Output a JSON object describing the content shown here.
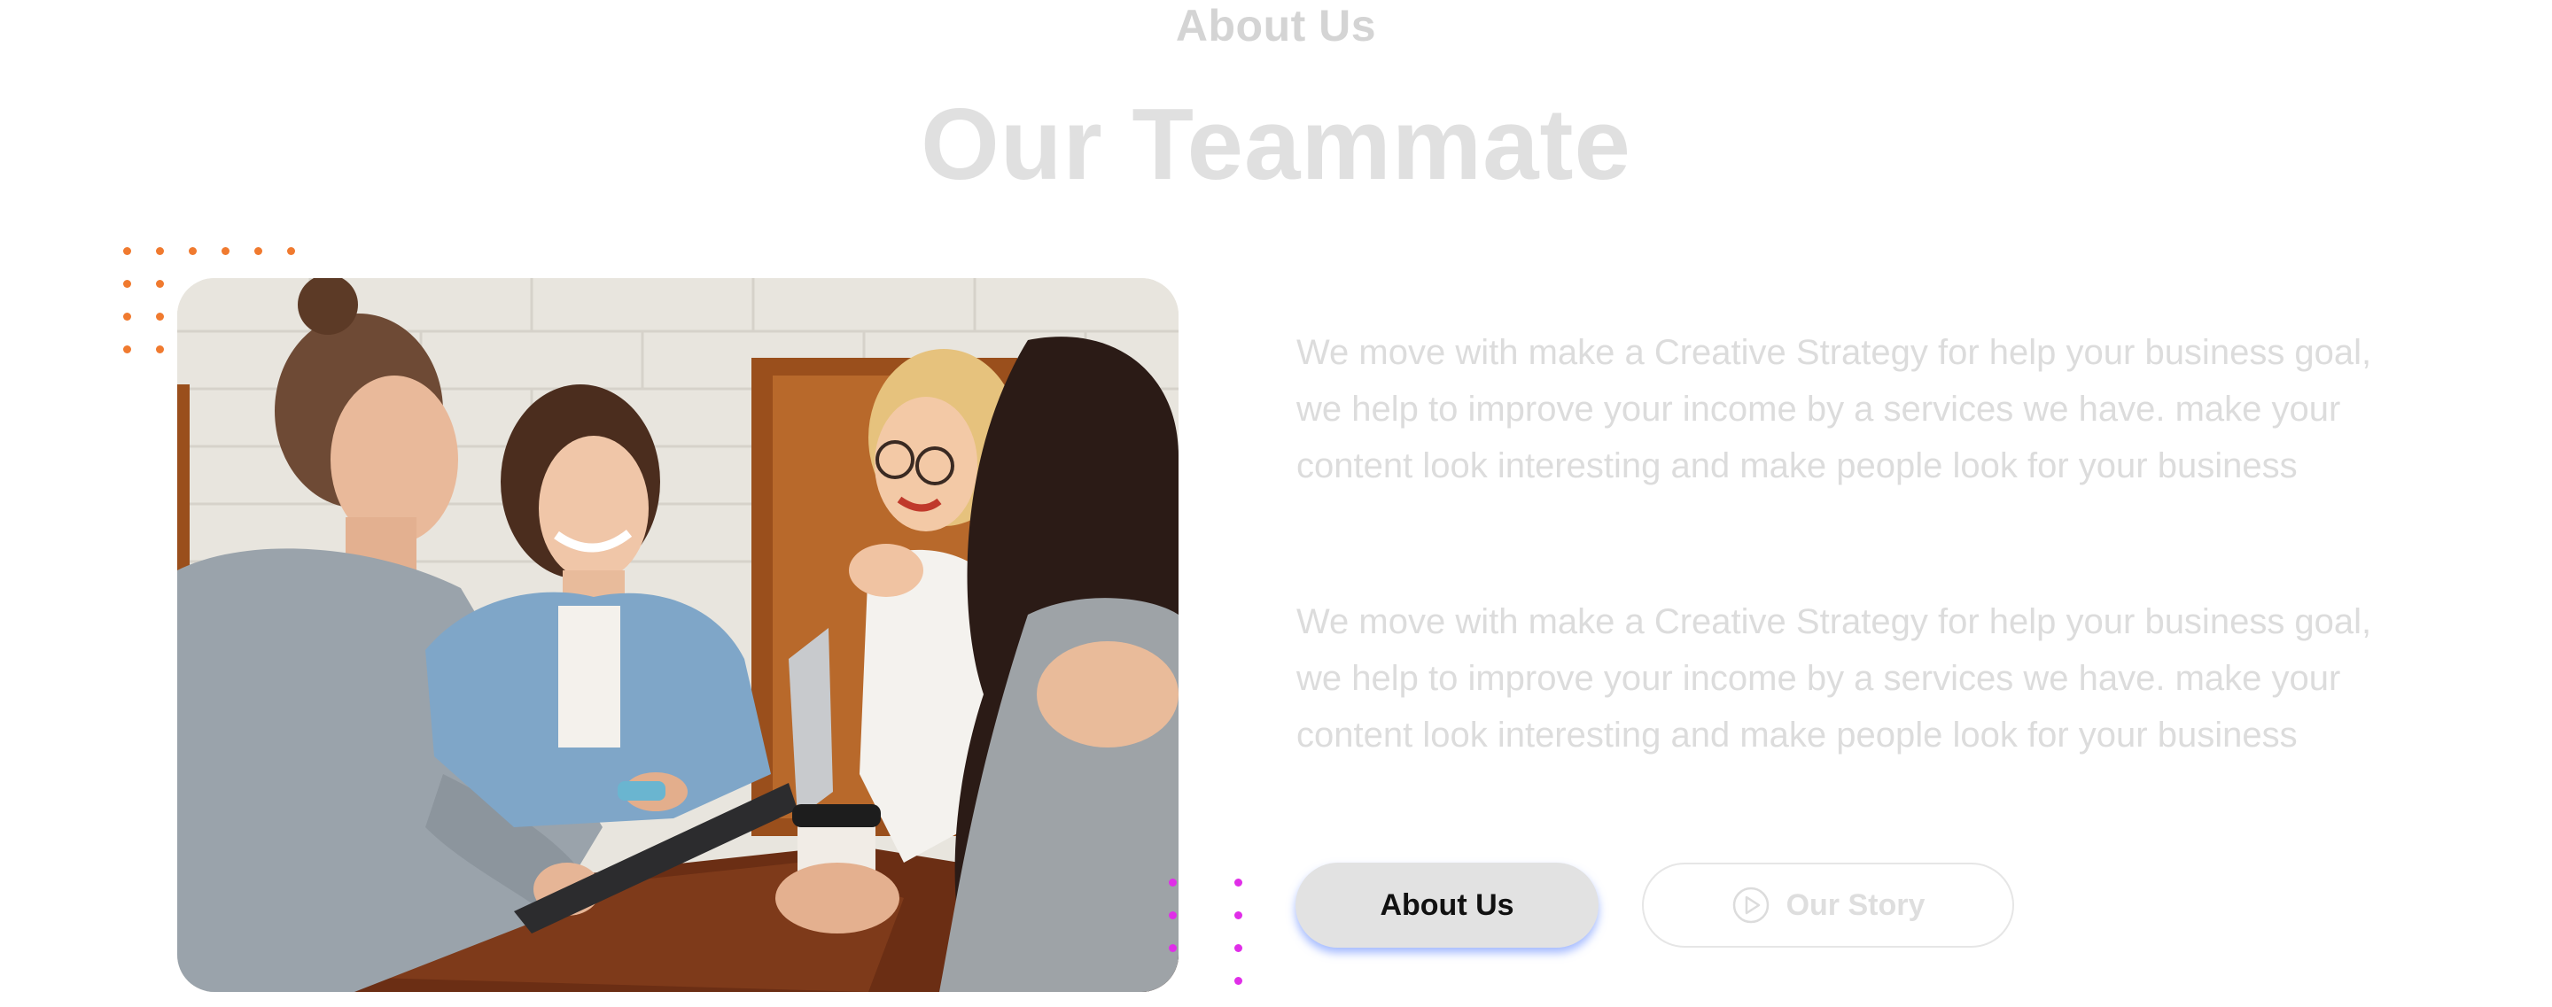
{
  "section": {
    "eyebrow": "About Us",
    "title": "Our Teammate"
  },
  "paragraphs": [
    "We move with make a Creative Strategy for help your business goal, we help to improve your income by a services we have. make your content look interesting and make people look for your business",
    "We move with make a Creative Strategy for help your business goal, we help to improve your income by a services we have. make your content look interesting and make people look for your business"
  ],
  "buttons": {
    "primary_label": "About Us",
    "secondary_label": "Our Story",
    "secondary_icon": "play-circle-icon"
  },
  "colors": {
    "dots_top_left": "#f07a2f",
    "dots_bottom_right": "#e02ee8",
    "primary_button_bg": "#e2e2e2",
    "primary_button_glow": "#5a82ff"
  }
}
